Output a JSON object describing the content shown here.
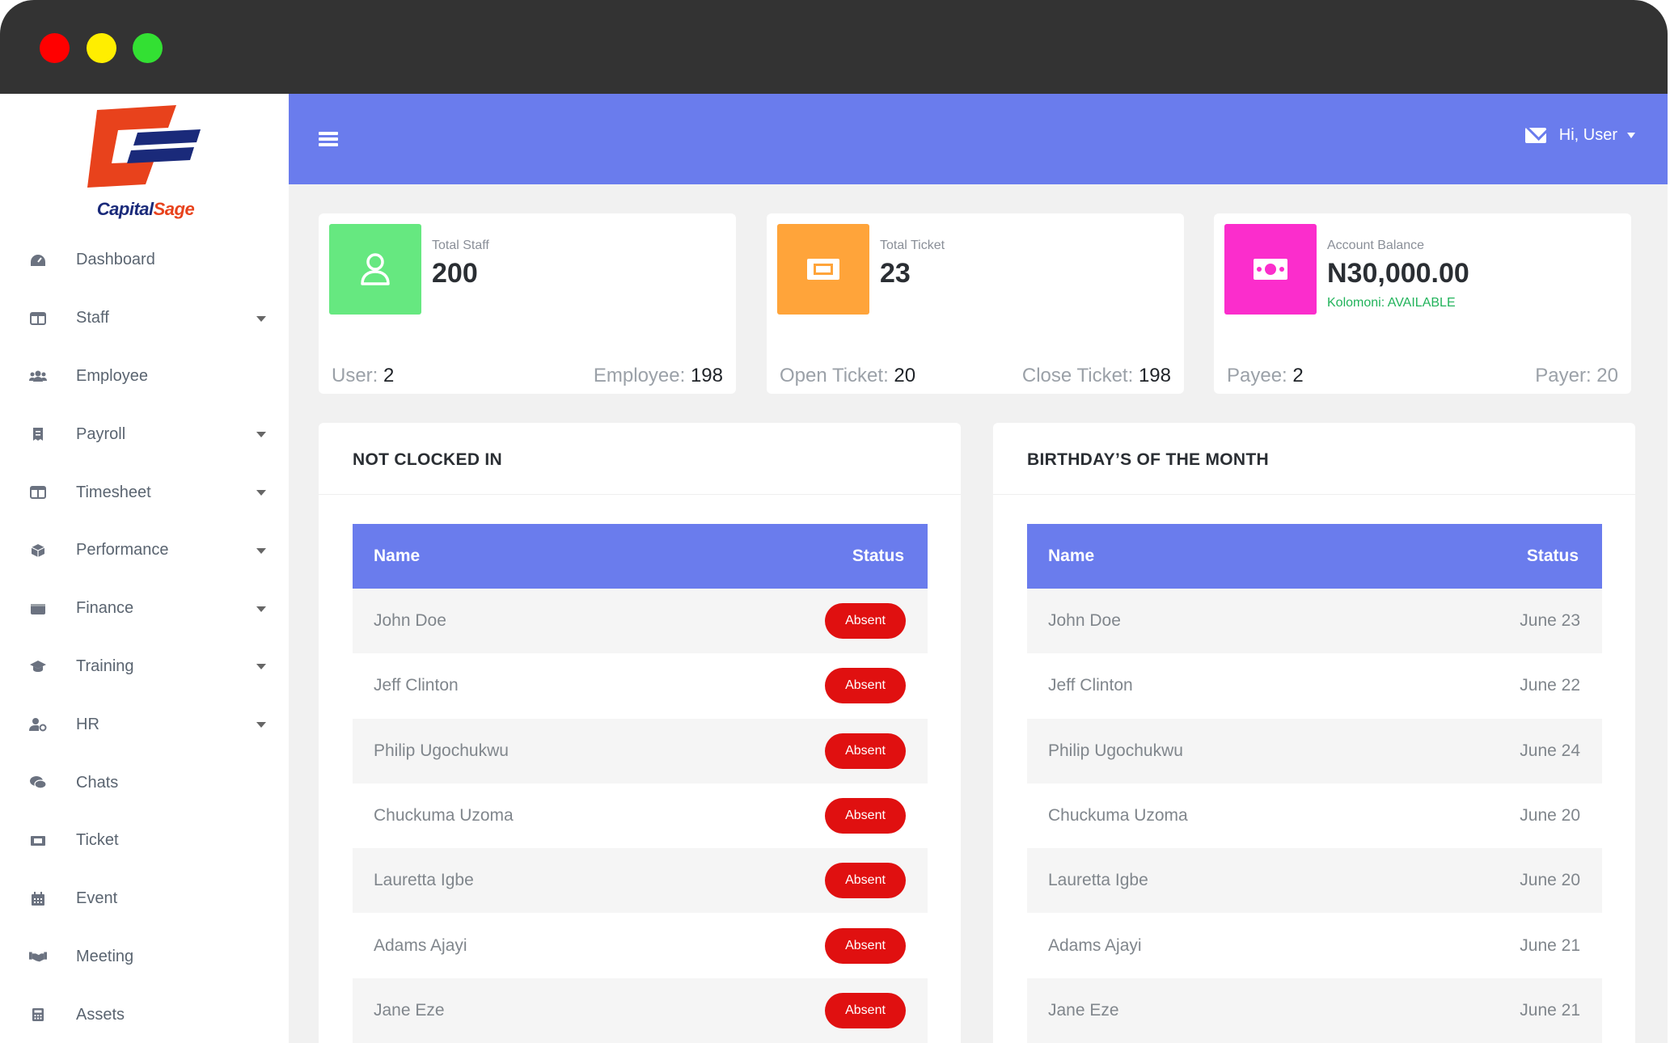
{
  "brand": {
    "name_part1": "Capital",
    "name_part2": "Sage",
    "primary": "#6a7ced"
  },
  "sidebar": {
    "items": [
      {
        "label": "Dashboard",
        "icon": "dashboard-icon",
        "has_caret": false
      },
      {
        "label": "Staff",
        "icon": "columns-icon",
        "has_caret": true
      },
      {
        "label": "Employee",
        "icon": "users-icon",
        "has_caret": false
      },
      {
        "label": "Payroll",
        "icon": "receipt-icon",
        "has_caret": true
      },
      {
        "label": "Timesheet",
        "icon": "columns-icon",
        "has_caret": true
      },
      {
        "label": "Performance",
        "icon": "cube-icon",
        "has_caret": true
      },
      {
        "label": "Finance",
        "icon": "wallet-icon",
        "has_caret": true
      },
      {
        "label": "Training",
        "icon": "graduation-cap-icon",
        "has_caret": true
      },
      {
        "label": "HR",
        "icon": "user-cog-icon",
        "has_caret": true
      },
      {
        "label": "Chats",
        "icon": "comments-icon",
        "has_caret": false
      },
      {
        "label": "Ticket",
        "icon": "ticket-icon",
        "has_caret": false
      },
      {
        "label": "Event",
        "icon": "calendar-icon",
        "has_caret": false
      },
      {
        "label": "Meeting",
        "icon": "handshake-icon",
        "has_caret": false
      },
      {
        "label": "Assets",
        "icon": "calculator-icon",
        "has_caret": false
      }
    ]
  },
  "header": {
    "greeting": "Hi, User"
  },
  "cards": [
    {
      "label": "Total Staff",
      "value": "200",
      "note": "",
      "left_label": "User:",
      "left_value": "2",
      "right_label": "Employee:",
      "right_value": "198",
      "color": "#66e880",
      "icon": "user-icon"
    },
    {
      "label": "Total Ticket",
      "value": "23",
      "note": "",
      "left_label": "Open Ticket:",
      "left_value": "20",
      "right_label": "Close Ticket:",
      "right_value": "198",
      "color": "#ffa43a",
      "icon": "ticket-icon"
    },
    {
      "label": "Account Balance",
      "value": "N30,000.00",
      "note": "Kolomoni: AVAILABLE",
      "left_label": "Payee:",
      "left_value": "2",
      "right_label": "Payer: 20",
      "right_value": "",
      "color": "#fb2dcc",
      "icon": "money-bill-icon"
    }
  ],
  "not_clocked_in": {
    "title": "NOT CLOCKED IN",
    "columns": [
      "Name",
      "Status"
    ],
    "rows": [
      {
        "name": "John Doe",
        "status": "Absent"
      },
      {
        "name": "Jeff Clinton",
        "status": "Absent"
      },
      {
        "name": "Philip Ugochukwu",
        "status": "Absent"
      },
      {
        "name": "Chuckuma Uzoma",
        "status": "Absent"
      },
      {
        "name": "Lauretta Igbe",
        "status": "Absent"
      },
      {
        "name": "Adams Ajayi",
        "status": "Absent"
      },
      {
        "name": "Jane Eze",
        "status": "Absent"
      }
    ]
  },
  "birthdays": {
    "title": "BIRTHDAY’S OF THE MONTH",
    "columns": [
      "Name",
      "Status"
    ],
    "rows": [
      {
        "name": "John Doe",
        "status": "June 23"
      },
      {
        "name": "Jeff Clinton",
        "status": "June 22"
      },
      {
        "name": "Philip Ugochukwu",
        "status": "June 24"
      },
      {
        "name": "Chuckuma Uzoma",
        "status": "June 20"
      },
      {
        "name": "Lauretta Igbe",
        "status": "June 20"
      },
      {
        "name": "Adams Ajayi",
        "status": "June 21"
      },
      {
        "name": "Jane Eze",
        "status": "June 21"
      }
    ]
  }
}
